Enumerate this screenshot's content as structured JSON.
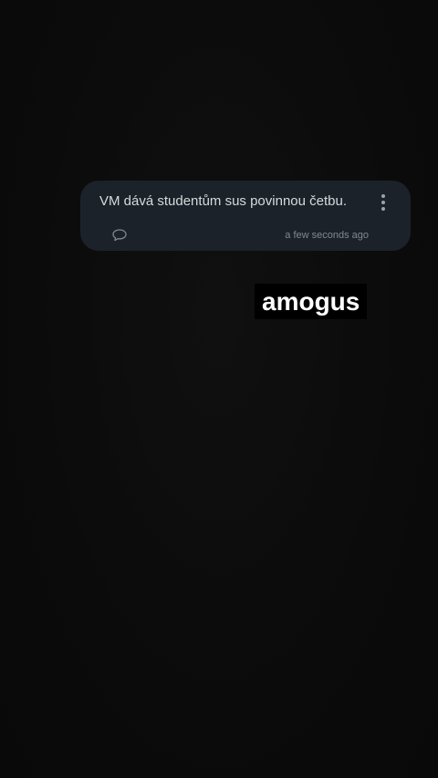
{
  "post": {
    "text": "VM dává studentům sus povinnou četbu.",
    "timestamp": "a few seconds ago",
    "menu_icon": "more-vertical-icon",
    "comment_icon": "comment-icon"
  },
  "overlay": {
    "caption": "amogus"
  },
  "colors": {
    "background": "#0b0b0b",
    "card": "#1c2229",
    "text": "#d6dade",
    "muted": "#7f8893",
    "caption_bg": "#000000",
    "caption_text": "#ffffff"
  }
}
